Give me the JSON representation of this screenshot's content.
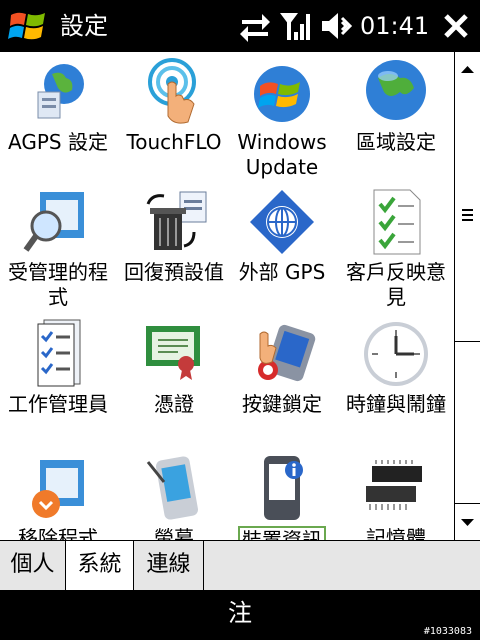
{
  "titlebar": {
    "title": "設定",
    "clock": "01:41",
    "icons": [
      "windows-start-icon",
      "connectivity-icon",
      "signal-icon",
      "volume-icon",
      "close-icon"
    ]
  },
  "items": [
    {
      "label": "AGPS 設定",
      "icon": "agps-globe-icon"
    },
    {
      "label": "TouchFLO",
      "icon": "touchflo-icon"
    },
    {
      "label": "Windows Update",
      "icon": "windows-update-icon"
    },
    {
      "label": "區域設定",
      "icon": "regional-globe-icon"
    },
    {
      "label": "受管理的程式",
      "icon": "managed-programs-icon"
    },
    {
      "label": "回復預設值",
      "icon": "reset-trash-icon"
    },
    {
      "label": "外部 GPS",
      "icon": "external-gps-icon"
    },
    {
      "label": "客戶反映意見",
      "icon": "feedback-checklist-icon"
    },
    {
      "label": "工作管理員",
      "icon": "task-manager-icon"
    },
    {
      "label": "憑證",
      "icon": "certificate-icon"
    },
    {
      "label": "按鍵鎖定",
      "icon": "key-lock-icon"
    },
    {
      "label": "時鐘與鬧鐘",
      "icon": "clock-icon"
    },
    {
      "label": "移除程式",
      "icon": "remove-programs-icon"
    },
    {
      "label": "螢幕",
      "icon": "screen-icon"
    },
    {
      "label": "裝置資訊",
      "icon": "device-info-icon"
    },
    {
      "label": "記憶體",
      "icon": "memory-chip-icon"
    }
  ],
  "tabs": [
    {
      "label": "個人",
      "active": false
    },
    {
      "label": "系統",
      "active": true
    },
    {
      "label": "連線",
      "active": false
    }
  ],
  "softkey": {
    "label": "注"
  },
  "footer_id": "#1033083"
}
